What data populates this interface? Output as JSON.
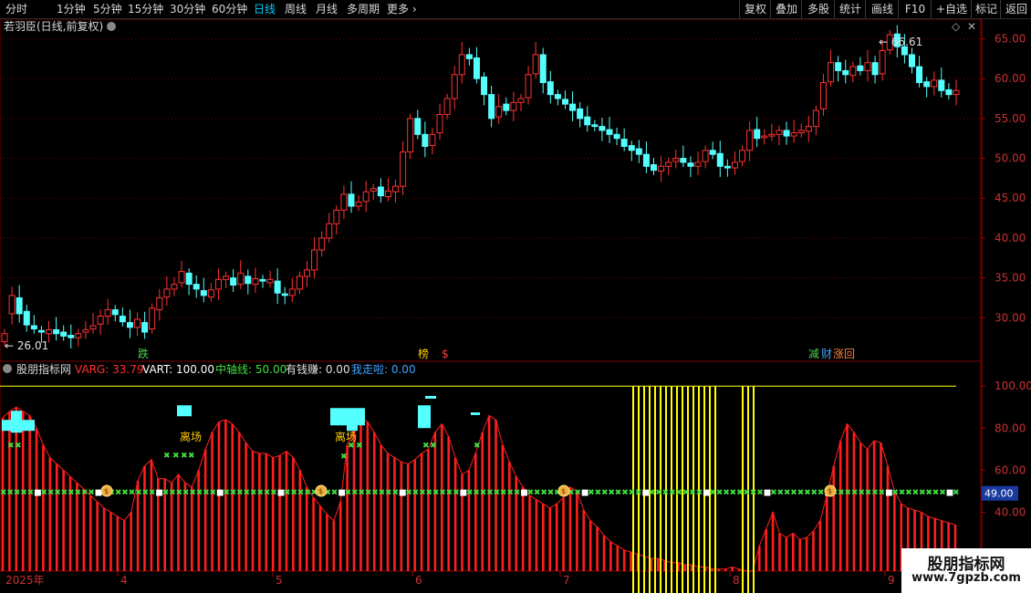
{
  "toolbar": {
    "periods": [
      "分时",
      "1分钟",
      "5分钟",
      "15分钟",
      "30分钟",
      "60分钟",
      "日线",
      "周线",
      "月线",
      "多周期",
      "更多"
    ],
    "active_period": "日线",
    "right_buttons": [
      "复权",
      "叠加",
      "多股",
      "统计",
      "画线",
      "F10",
      "+自选",
      "标记",
      "返回"
    ]
  },
  "main_panel": {
    "title": "若羽臣(日线,前复权)",
    "high_marker": "66.61",
    "low_marker": "26.01",
    "signals": [
      {
        "text": "跌",
        "color": "#4bd34b"
      },
      {
        "text": "榜",
        "color": "#ffcc00"
      },
      {
        "text": "$",
        "color": "#ff4040"
      },
      {
        "text": "减",
        "color": "#4bd34b"
      },
      {
        "text": "财",
        "color": "#40a0ff"
      },
      {
        "text": "涨回",
        "color": "#ff8040"
      }
    ]
  },
  "indicator_panel": {
    "name": "股朋指标网",
    "fields": [
      {
        "label": "VARG:",
        "value": "33.79",
        "color": "#ff3030"
      },
      {
        "label": "VART:",
        "value": "100.00",
        "color": "#ffffff"
      },
      {
        "label": "中轴线:",
        "value": "50.00",
        "color": "#40e040"
      },
      {
        "label": "有钱赚:",
        "value": "0.00",
        "color": "#e0e0e0"
      },
      {
        "label": "我走啦:",
        "value": "0.00",
        "color": "#40a0ff"
      }
    ],
    "current_value": "49.00",
    "annotations": [
      "离场",
      "离场"
    ]
  },
  "xaxis": {
    "labels": [
      "2025年",
      "4",
      "5",
      "6",
      "7",
      "8",
      "9"
    ]
  },
  "watermark": {
    "line1": "股朋指标网",
    "line2": "www.7gpzb.com"
  },
  "colors": {
    "up": "#ff3232",
    "down": "#54ffff",
    "grid": "#7a0000",
    "yellow": "#ffff00"
  },
  "chart_data": [
    {
      "type": "candlestick",
      "ylim": [
        25,
        67
      ],
      "yticks": [
        "30.00",
        "35.00",
        "40.00",
        "45.00",
        "50.00",
        "55.00",
        "60.00",
        "65.00"
      ],
      "close": [
        28.0,
        32.8,
        30.5,
        29.1,
        28.6,
        28.2,
        28.5,
        28.0,
        27.7,
        27.5,
        28.0,
        28.5,
        29.0,
        30.2,
        31.0,
        30.4,
        29.5,
        28.8,
        29.8,
        28.2,
        31.2,
        32.5,
        33.6,
        34.2,
        35.8,
        34.2,
        33.6,
        32.8,
        33.5,
        34.8,
        35.2,
        34.1,
        35.6,
        34.3,
        34.9,
        34.6,
        34.8,
        33.1,
        32.8,
        33.6,
        35.2,
        36.0,
        38.5,
        40.0,
        41.8,
        43.5,
        45.5,
        44.0,
        44.5,
        45.8,
        46.2,
        45.3,
        45.9,
        46.5,
        50.8,
        55.0,
        53.0,
        51.5,
        53.0,
        55.5,
        57.5,
        60.5,
        63.0,
        62.5,
        60.0,
        58.0,
        55.0,
        56.5,
        56.0,
        57.0,
        57.5,
        60.5,
        63.0,
        59.5,
        58.0,
        57.5,
        56.8,
        56.0,
        55.0,
        54.2,
        54.0,
        53.5,
        53.0,
        52.5,
        51.5,
        51.0,
        50.5,
        49.0,
        48.5,
        49.0,
        49.5,
        50.0,
        49.5,
        49.0,
        49.5,
        51.0,
        50.5,
        49.0,
        48.8,
        49.5,
        51.0,
        53.5,
        52.5,
        52.8,
        53.0,
        53.5,
        52.8,
        53.2,
        53.5,
        54.0,
        56.0,
        59.5,
        62.0,
        61.0,
        60.5,
        61.5,
        61.0,
        62.0,
        60.5,
        63.5,
        65.5,
        64.0,
        63.0,
        61.5,
        59.5,
        59.0,
        59.8,
        58.5,
        58.0,
        58.5
      ],
      "open": [
        27.0,
        30.5,
        32.5,
        30.8,
        29.0,
        28.4,
        28.0,
        28.5,
        28.2,
        27.8,
        27.5,
        28.2,
        28.6,
        29.2,
        30.2,
        31.0,
        30.2,
        29.4,
        28.8,
        29.4,
        28.6,
        31.0,
        32.6,
        33.6,
        34.4,
        35.6,
        34.2,
        33.4,
        32.6,
        33.6,
        34.8,
        35.0,
        34.2,
        35.2,
        34.2,
        34.8,
        34.4,
        34.6,
        33.0,
        32.8,
        33.6,
        35.2,
        36.0,
        38.5,
        40.0,
        41.8,
        43.5,
        45.5,
        44.0,
        44.6,
        45.9,
        46.4,
        45.2,
        45.8,
        46.5,
        50.8,
        55.0,
        53.0,
        51.6,
        53.2,
        55.5,
        57.5,
        60.5,
        63.0,
        62.6,
        60.2,
        58.0,
        55.2,
        56.8,
        56.0,
        57.0,
        57.6,
        60.6,
        63.0,
        59.6,
        58.0,
        57.4,
        56.8,
        56.2,
        55.2,
        54.2,
        54.0,
        53.6,
        53.0,
        52.4,
        51.6,
        51.2,
        50.5,
        49.2,
        48.4,
        49.0,
        49.6,
        50.0,
        49.4,
        49.0,
        49.6,
        51.0,
        50.6,
        49.0,
        48.8,
        49.6,
        51.0,
        53.6,
        52.6,
        52.8,
        53.0,
        53.5,
        52.8,
        53.2,
        53.4,
        54.0,
        56.2,
        59.6,
        62.0,
        61.0,
        60.4,
        61.6,
        61.0,
        62.0,
        60.6,
        63.6,
        65.6,
        64.0,
        63.0,
        61.5,
        59.6,
        59.0,
        59.8,
        58.6,
        58.0
      ]
    },
    {
      "type": "bar",
      "ylim": [
        12,
        104
      ],
      "yticks": [
        "20.00",
        "40.00",
        "60.00",
        "80.00",
        "100.00"
      ],
      "middle_axis": 50,
      "values": [
        85,
        88,
        90,
        88,
        86,
        80,
        72,
        66,
        63,
        60,
        57,
        54,
        51,
        48,
        45,
        42,
        40,
        38,
        36,
        40,
        55,
        62,
        65,
        56,
        56,
        54,
        58,
        54,
        52,
        60,
        70,
        78,
        83,
        84,
        82,
        78,
        73,
        69,
        68,
        68,
        66,
        67,
        69,
        66,
        60,
        52,
        47,
        43,
        39,
        36,
        45,
        72,
        80,
        85,
        83,
        78,
        72,
        68,
        66,
        64,
        63,
        65,
        68,
        70,
        78,
        82,
        76,
        66,
        58,
        60,
        68,
        78,
        86,
        84,
        72,
        64,
        57,
        52,
        48,
        46,
        44,
        42,
        44,
        47,
        52,
        50,
        41,
        36,
        33,
        29,
        26,
        24,
        22,
        21,
        20,
        19,
        18,
        18,
        17,
        16,
        16,
        15,
        15,
        14,
        14,
        13,
        13,
        13,
        14,
        13,
        12,
        12,
        24,
        32,
        40,
        30,
        28,
        30,
        27,
        28,
        31,
        36,
        48,
        62,
        74,
        82,
        78,
        73,
        70,
        74,
        73,
        62,
        50,
        44,
        42,
        41,
        40,
        38,
        37,
        36,
        35,
        34
      ],
      "vart_line": 100,
      "yellow_dips": [
        [
          694,
          700
        ],
        [
          700,
          695
        ],
        [
          706,
          701
        ],
        [
          712,
          695
        ],
        [
          718,
          695
        ],
        [
          724,
          705
        ],
        [
          730,
          700
        ],
        [
          736,
          710
        ],
        [
          742,
          706
        ],
        [
          748,
          700
        ],
        [
          754,
          698
        ],
        [
          760,
          694
        ],
        [
          766,
          698
        ],
        [
          772,
          706
        ],
        [
          778,
          700
        ],
        [
          784,
          704
        ],
        [
          814,
          700
        ],
        [
          820,
          708
        ],
        [
          826,
          700
        ]
      ]
    }
  ]
}
